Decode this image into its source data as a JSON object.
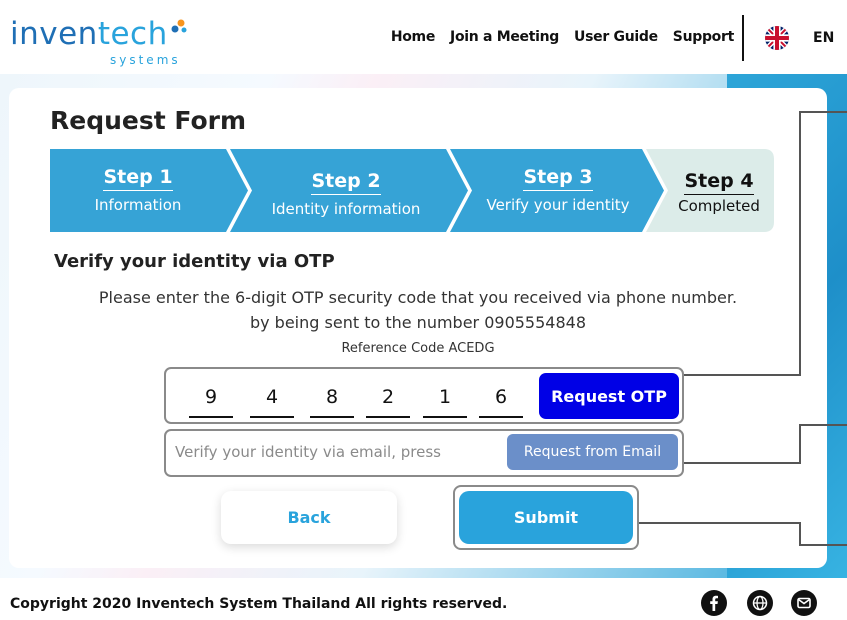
{
  "header": {
    "logo_main": "inven",
    "logo_accent": "tech",
    "logo_sub": "systems",
    "nav": [
      "Home",
      "Join a Meeting",
      "User Guide",
      "Support"
    ],
    "language": "EN",
    "flag_icon": "uk-flag-icon"
  },
  "form": {
    "title": "Request Form",
    "steps": [
      {
        "number": "Step 1",
        "label": "Information",
        "state": "done"
      },
      {
        "number": "Step 2",
        "label": "Identity information",
        "state": "done"
      },
      {
        "number": "Step 3",
        "label": "Verify your identity",
        "state": "active"
      },
      {
        "number": "Step 4",
        "label": "Completed",
        "state": "pending"
      }
    ],
    "section_title": "Verify your identity via OTP",
    "description_line1": "Please enter the 6-digit OTP security code that you received via phone number.",
    "description_line2": "by being sent to the number 0905554848",
    "reference": "Reference Code ACEDG",
    "otp_digits": [
      "9",
      "4",
      "8",
      "2",
      "1",
      "6"
    ],
    "request_otp_label": "Request OTP",
    "email_prompt": "Verify your identity via email, press",
    "request_email_label": "Request from Email",
    "back_label": "Back",
    "submit_label": "Submit"
  },
  "footer": {
    "copyright": "Copyright  2020 Inventech System Thailand All rights reserved.",
    "icons": [
      "facebook-icon",
      "globe-icon",
      "mail-icon"
    ]
  },
  "colors": {
    "primary": "#29a3dc",
    "step_done": "#36a3d6",
    "step_pending": "#dcece9",
    "otp_button": "#0000e6",
    "email_button": "#6b8fc9"
  }
}
